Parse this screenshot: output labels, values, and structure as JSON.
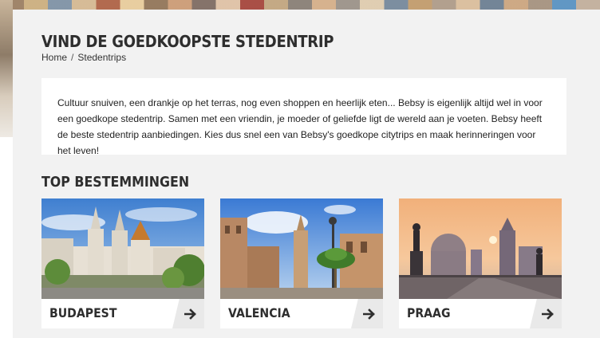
{
  "page": {
    "title": "VIND DE GOEDKOOPSTE STEDENTRIP",
    "breadcrumb": {
      "home": "Home",
      "separator": "/",
      "current": "Stedentrips"
    },
    "intro": "Cultuur snuiven, een drankje op het terras, nog even shoppen en heerlijk eten... Bebsy is eigenlijk altijd wel in voor een goedkope stedentrip. Samen met een vriendin, je moeder of geliefde ligt de wereld aan je voeten. Bebsy heeft de beste stedentrip aanbiedingen. Kies dus snel een van Bebsy's goedkope citytrips en maak herinneringen voor het leven!"
  },
  "destinations": {
    "title": "TOP BESTEMMINGEN",
    "cards": [
      {
        "city": "BUDAPEST",
        "arrow_icon": "arrow-right-icon"
      },
      {
        "city": "VALENCIA",
        "arrow_icon": "arrow-right-icon"
      },
      {
        "city": "PRAAG",
        "arrow_icon": "arrow-right-icon"
      }
    ]
  },
  "colors": {
    "panel_bg": "#f2f2f2",
    "heading_text": "#2e2e2e",
    "card_arrow_bg": "#e9e9e9"
  }
}
